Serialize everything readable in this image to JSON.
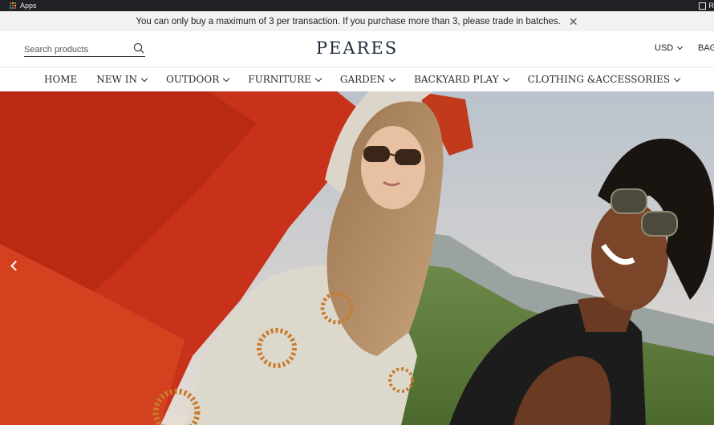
{
  "browser": {
    "bookmarks_apps_label": "Apps",
    "reading_list_label": "R"
  },
  "announcement": {
    "text": "You can only buy a maximum of 3 per transaction. If you purchase more than 3, please trade in batches.",
    "close_glyph": "✕"
  },
  "header": {
    "search_placeholder": "Search products",
    "logo": "PEARES",
    "currency": "USD",
    "bag_label": "BAG"
  },
  "nav": {
    "items": [
      {
        "label": "HOME",
        "has_dropdown": false
      },
      {
        "label": "NEW IN",
        "has_dropdown": true
      },
      {
        "label": "OUTDOOR",
        "has_dropdown": true
      },
      {
        "label": "FURNITURE",
        "has_dropdown": true
      },
      {
        "label": "GARDEN",
        "has_dropdown": true
      },
      {
        "label": "BACKYARD PLAY",
        "has_dropdown": true
      },
      {
        "label": "CLOTHING &ACCESSORIES",
        "has_dropdown": true
      }
    ]
  },
  "hero": {
    "prev_icon": "chevron-left-icon"
  },
  "colors": {
    "brand_text": "#1d2a3a",
    "announcement_bg": "#f2f2f2",
    "hero_red": "#c8321a"
  }
}
